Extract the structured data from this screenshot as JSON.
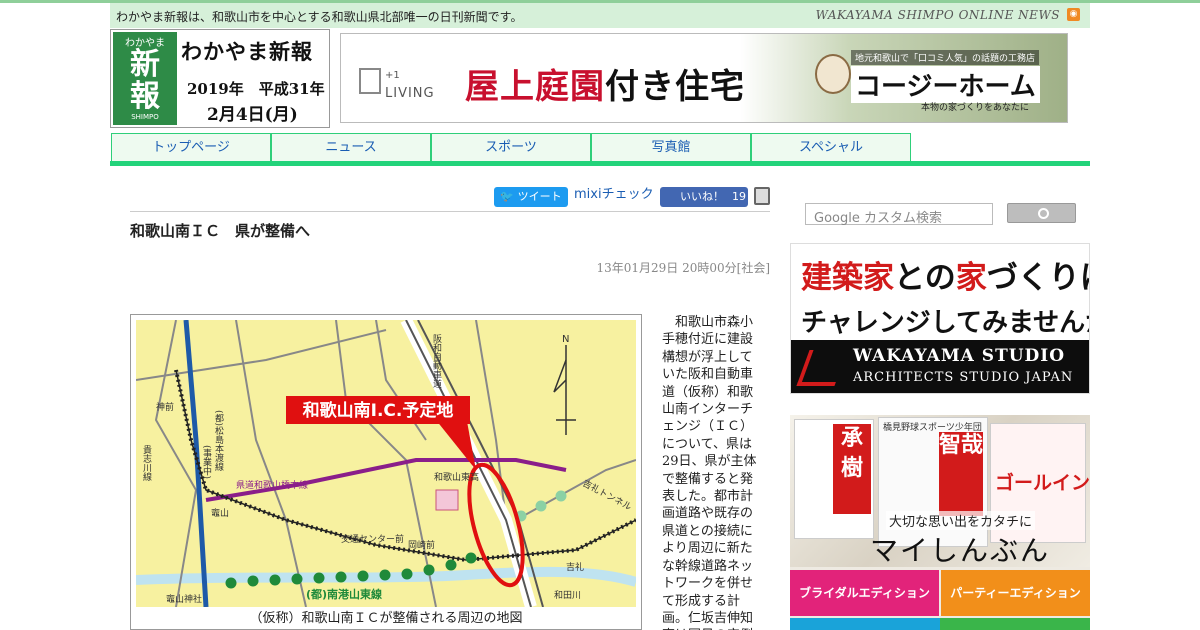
{
  "header": {
    "tagline": "わかやま新報は、和歌山市を中心とする和歌山県北部唯一の日刊新聞です。",
    "site_name": "WAKAYAMA SHIMPO ONLINE NEWS",
    "rss_icon": "rss-icon"
  },
  "logo": {
    "small_text": "わかやま",
    "mark_text": "新報",
    "shimpo": "SHIMPO",
    "title": "わかやま新報",
    "date_line1": "2019年　平成31年",
    "date_line2": "2月4日(月)"
  },
  "banner": {
    "brand_small": "+1",
    "brand": "LIVING",
    "headline_red": "屋上庭園",
    "headline_black": "付き住宅",
    "company_sub": "地元和歌山で「口コミ人気」の話題の工務店",
    "company": "コージーホーム",
    "motto": "本物の家づくりをあなたに"
  },
  "nav": {
    "tabs": [
      "トップページ",
      "ニュース",
      "スポーツ",
      "写真館",
      "スペシャル"
    ]
  },
  "social": {
    "tweet_label": "ツイート",
    "mixi_label": "mixiチェック",
    "like_label": "いいね！",
    "like_count": "19",
    "print_icon": "print-icon"
  },
  "article": {
    "title": "和歌山南ＩＣ　県が整備へ",
    "meta": "13年01月29日 20時00分[社会]",
    "figure_caption": "（仮称）和歌山南ＩＣが整備される周辺の地図",
    "body": "和歌山市森小手穂付近に建設構想が浮上していた阪和自動車道（仮称）和歌山南インターチェンジ（ＩＣ）について、県は29日、県が主体で整備すると発表した。都市計画道路や既存の県道との接続により周辺に新たな幹線道路ネットワークを併せて形成する計画。仁坂吉伸知事は同日の定例記者会見で「和"
  },
  "map": {
    "highlight": "和歌山南I.C.予定地",
    "expressway": "阪和自動車道",
    "labels": {
      "jinzen": "神前",
      "kishigawa": "貴志川線",
      "matsushima": "(都)松島本渡線",
      "jisaku": "(事業中)",
      "kendo": "県道和歌山橋本線",
      "kamayama": "竈山",
      "kotsu": "交通センター前",
      "okazaki": "岡崎前",
      "higashi": "和歌山東高",
      "kire_tunnel": "吉礼トンネル",
      "kire": "吉礼",
      "nankou": "(都)南港山東線",
      "wadagawa": "和田川",
      "shrine": "竈山神社",
      "north": "N"
    }
  },
  "sidebar": {
    "search_placeholder": "Google カスタム検索",
    "ad1_line1_red1": "建築家",
    "ad1_line1_a": "との",
    "ad1_line1_red2": "家",
    "ad1_line1_b": "づくりに",
    "ad1_line2": "チャレンジしてみませんか?",
    "ad1_studio": "WAKAYAMA STUDIO",
    "ad1_sub": "ARCHITECTS STUDIO JAPAN",
    "ad2_p1": "承樹",
    "ad2_p2_head": "橋見野球スポーツ少年団",
    "ad2_p2": "智哉",
    "ad2_p3": "ゴールイン",
    "ad2_catch": "大切な思い出をカタチに",
    "ad2_brand": "マイしんぶん",
    "ad2_btn1": "ブライダルエディション",
    "ad2_btn2": "パーティーエディション"
  }
}
